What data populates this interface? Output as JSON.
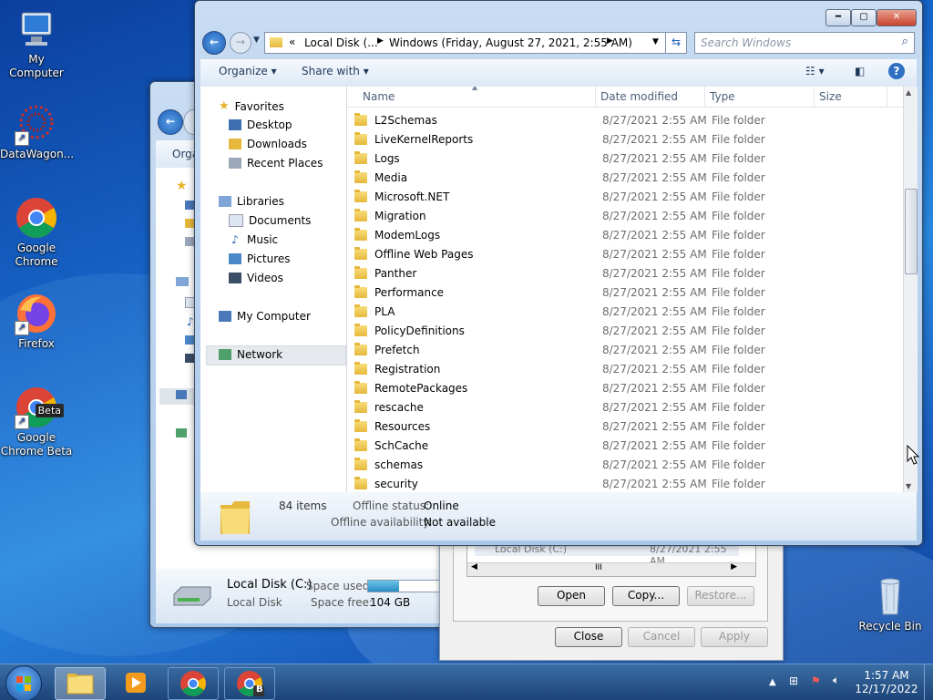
{
  "desktop": {
    "icons": [
      {
        "label": "My Computer",
        "icon": "computer-icon"
      },
      {
        "label": "DataWagon...",
        "icon": "datawagon-icon"
      },
      {
        "label": "Google Chrome",
        "icon": "chrome-icon"
      },
      {
        "label": "Firefox",
        "icon": "firefox-icon"
      },
      {
        "label": "Google Chrome Beta",
        "icon": "chrome-beta-icon",
        "badge": "Beta"
      },
      {
        "label": "Recycle Bin",
        "icon": "recycle-bin-icon"
      }
    ]
  },
  "back_window": {
    "organize_label": "Orga",
    "drive_name": "Local Disk (C:)",
    "drive_type": "Local Disk",
    "space_used_label": "Space used:",
    "space_free_label": "Space free:",
    "space_free_value": "104 GB",
    "space_used_fraction": 0.35
  },
  "properties_dialog": {
    "list_item_name": "Local Disk (C:)",
    "list_item_date": "8/27/2021 2:55 AM",
    "scroll_glyph": "III",
    "open_label": "Open",
    "copy_label": "Copy...",
    "restore_label": "Restore...",
    "close_label": "Close",
    "cancel_label": "Cancel",
    "apply_label": "Apply"
  },
  "explorer": {
    "breadcrumb": {
      "overflow": "«",
      "segments": [
        "Local Disk (...",
        "Windows (Friday, August 27, 2021, 2:55 AM)"
      ]
    },
    "search_placeholder": "Search Windows",
    "toolbar": {
      "organize": "Organize",
      "share_with": "Share with"
    },
    "nav": {
      "favorites": "Favorites",
      "desktop": "Desktop",
      "downloads": "Downloads",
      "recent_places": "Recent Places",
      "libraries": "Libraries",
      "documents": "Documents",
      "music": "Music",
      "pictures": "Pictures",
      "videos": "Videos",
      "my_computer": "My Computer",
      "network": "Network"
    },
    "columns": {
      "name": "Name",
      "date_modified": "Date modified",
      "type": "Type",
      "size": "Size"
    },
    "rows": [
      {
        "name": "L2Schemas",
        "date": "8/27/2021 2:55 AM",
        "type": "File folder"
      },
      {
        "name": "LiveKernelReports",
        "date": "8/27/2021 2:55 AM",
        "type": "File folder"
      },
      {
        "name": "Logs",
        "date": "8/27/2021 2:55 AM",
        "type": "File folder"
      },
      {
        "name": "Media",
        "date": "8/27/2021 2:55 AM",
        "type": "File folder"
      },
      {
        "name": "Microsoft.NET",
        "date": "8/27/2021 2:55 AM",
        "type": "File folder"
      },
      {
        "name": "Migration",
        "date": "8/27/2021 2:55 AM",
        "type": "File folder"
      },
      {
        "name": "ModemLogs",
        "date": "8/27/2021 2:55 AM",
        "type": "File folder"
      },
      {
        "name": "Offline Web Pages",
        "date": "8/27/2021 2:55 AM",
        "type": "File folder"
      },
      {
        "name": "Panther",
        "date": "8/27/2021 2:55 AM",
        "type": "File folder"
      },
      {
        "name": "Performance",
        "date": "8/27/2021 2:55 AM",
        "type": "File folder"
      },
      {
        "name": "PLA",
        "date": "8/27/2021 2:55 AM",
        "type": "File folder"
      },
      {
        "name": "PolicyDefinitions",
        "date": "8/27/2021 2:55 AM",
        "type": "File folder"
      },
      {
        "name": "Prefetch",
        "date": "8/27/2021 2:55 AM",
        "type": "File folder"
      },
      {
        "name": "Registration",
        "date": "8/27/2021 2:55 AM",
        "type": "File folder"
      },
      {
        "name": "RemotePackages",
        "date": "8/27/2021 2:55 AM",
        "type": "File folder"
      },
      {
        "name": "rescache",
        "date": "8/27/2021 2:55 AM",
        "type": "File folder"
      },
      {
        "name": "Resources",
        "date": "8/27/2021 2:55 AM",
        "type": "File folder"
      },
      {
        "name": "SchCache",
        "date": "8/27/2021 2:55 AM",
        "type": "File folder"
      },
      {
        "name": "schemas",
        "date": "8/27/2021 2:55 AM",
        "type": "File folder"
      },
      {
        "name": "security",
        "date": "8/27/2021 2:55 AM",
        "type": "File folder"
      }
    ],
    "details": {
      "count": "84 items",
      "offline_status_label": "Offline status:",
      "offline_status_value": "Online",
      "offline_availability_label": "Offline availability:",
      "offline_availability_value": "Not available"
    }
  },
  "taskbar": {
    "time": "1:57 AM",
    "date": "12/17/2022",
    "chrome_beta_badge": "B"
  },
  "colors": {
    "accent": "#3a6ea5",
    "selection": "#d9e8fb",
    "close": "#c7432d"
  }
}
